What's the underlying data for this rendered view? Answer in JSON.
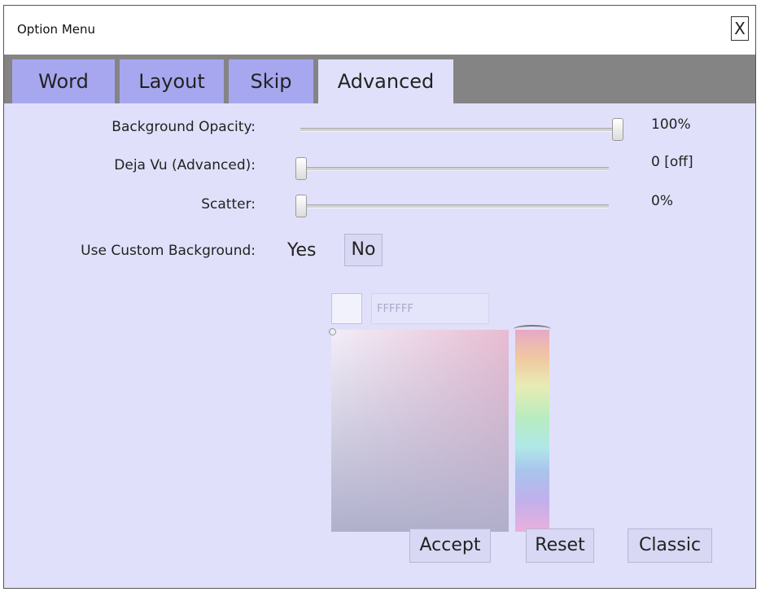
{
  "window": {
    "title": "Option Menu",
    "close_label": "X"
  },
  "tabs": [
    {
      "label": "Word"
    },
    {
      "label": "Layout"
    },
    {
      "label": "Skip"
    },
    {
      "label": "Advanced"
    }
  ],
  "active_tab": "Advanced",
  "settings": {
    "background_opacity": {
      "label": "Background Opacity:",
      "value_text": "100%",
      "level": 1.0
    },
    "deja_vu": {
      "label": "Deja Vu (Advanced):",
      "value_text": "0 [off]",
      "level": 0.0
    },
    "scatter": {
      "label": "Scatter:",
      "value_text": "0%",
      "level": 0.0
    }
  },
  "custom_background": {
    "label": "Use Custom Background:",
    "yes_label": "Yes",
    "no_label": "No",
    "selected": "No"
  },
  "color_picker": {
    "hex_value": "FFFFFF",
    "swatch_color": "#F2F2FC",
    "hue_gradient": "pastel rainbow"
  },
  "buttons": {
    "accept": "Accept",
    "reset": "Reset",
    "classic": "Classic"
  },
  "colors": {
    "panel_bg": "#E0E0FA",
    "tab_bg": "#A7A7F0",
    "tabbar_bg": "#848484"
  }
}
